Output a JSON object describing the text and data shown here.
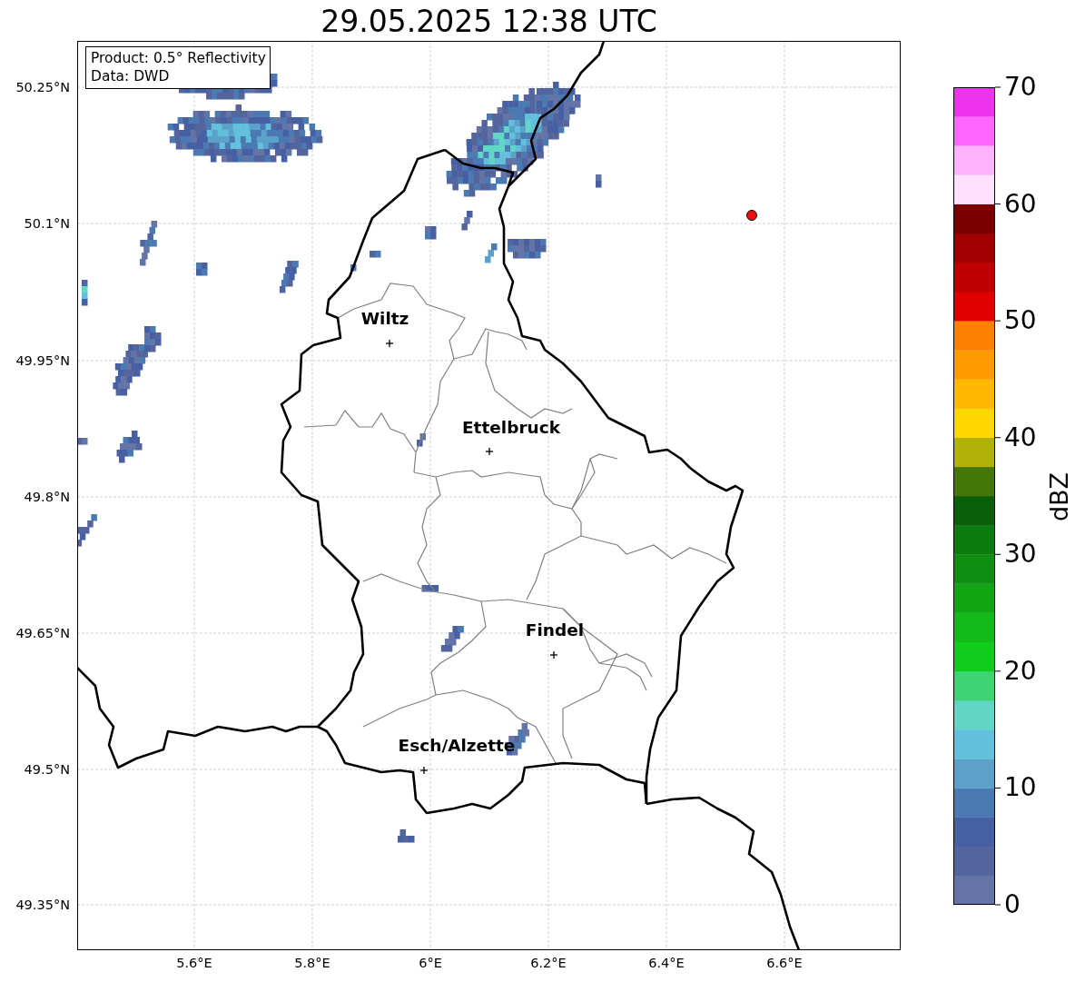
{
  "title": "29.05.2025 12:38 UTC",
  "info_box": [
    "Product: 0.5° Reflectivity",
    "Data: DWD"
  ],
  "y_axis_ticks": [
    "50.25°N",
    "50.1°N",
    "49.95°N",
    "49.8°N",
    "49.65°N",
    "49.5°N",
    "49.35°N"
  ],
  "x_axis_ticks": [
    "5.6°E",
    "5.8°E",
    "6°E",
    "6.2°E",
    "6.4°E",
    "6.6°E"
  ],
  "cities": [
    {
      "name": "Wiltz"
    },
    {
      "name": "Ettelbruck"
    },
    {
      "name": "Findel"
    },
    {
      "name": "Esch/Alzette"
    }
  ],
  "colorbar": {
    "label": "dBZ",
    "ticks": [
      "70",
      "60",
      "50",
      "40",
      "30",
      "20",
      "10",
      "0"
    ],
    "segments": [
      {
        "color": "#6574a6"
      },
      {
        "color": "#54659d"
      },
      {
        "color": "#4660a3"
      },
      {
        "color": "#4b7ab2"
      },
      {
        "color": "#5ba1c9"
      },
      {
        "color": "#63c0dc"
      },
      {
        "color": "#61d6c6"
      },
      {
        "color": "#3dd573"
      },
      {
        "color": "#12cc1c"
      },
      {
        "color": "#12bb18"
      },
      {
        "color": "#11a514"
      },
      {
        "color": "#0f8f12"
      },
      {
        "color": "#0d7c10"
      },
      {
        "color": "#0a5f0a"
      },
      {
        "color": "#45760a"
      },
      {
        "color": "#b0b20a"
      },
      {
        "color": "#ffd700"
      },
      {
        "color": "#ffb800"
      },
      {
        "color": "#ff9a00"
      },
      {
        "color": "#ff7f00"
      },
      {
        "color": "#e00000"
      },
      {
        "color": "#c00000"
      },
      {
        "color": "#a00000"
      },
      {
        "color": "#7a0000"
      },
      {
        "color": "#ffe0ff"
      },
      {
        "color": "#ffb3ff"
      },
      {
        "color": "#ff66ff"
      },
      {
        "color": "#ee33ee"
      }
    ]
  }
}
